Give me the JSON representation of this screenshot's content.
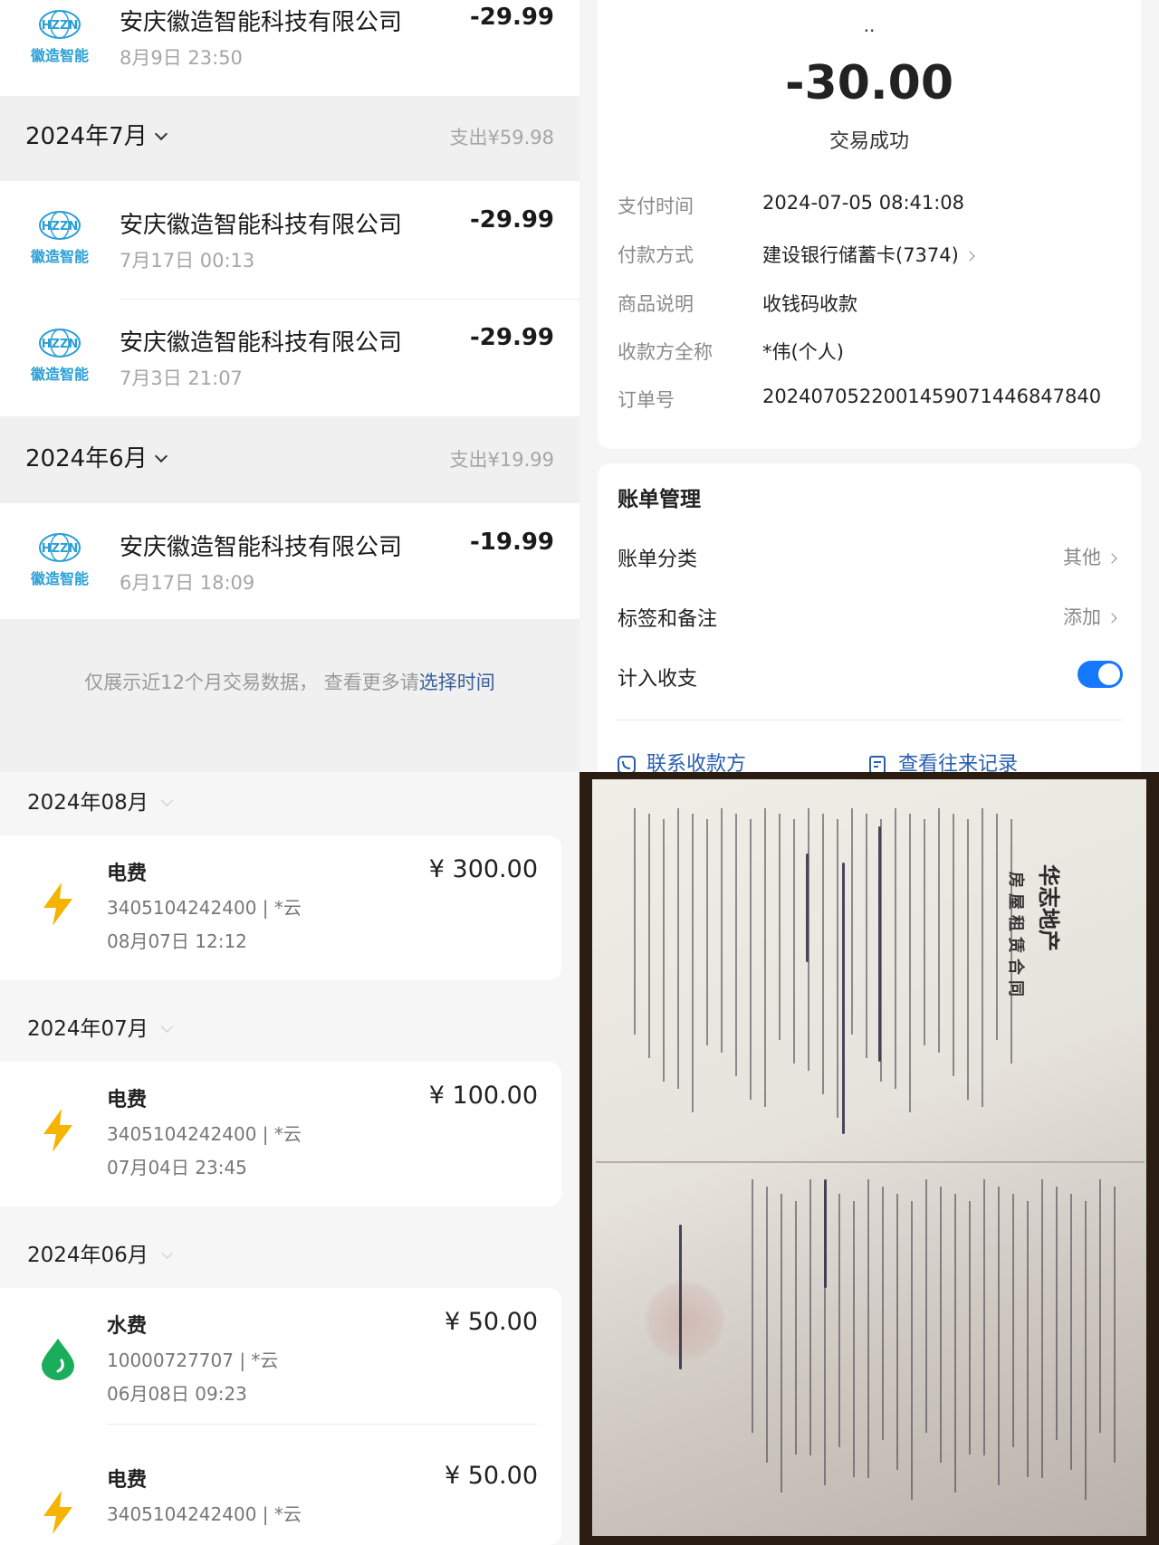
{
  "transactions_panel": {
    "brand_text": "徽造智能",
    "globe_text": "HZZN",
    "top_txn": {
      "name": "安庆徽造智能科技有限公司",
      "time": "8月9日 23:50",
      "amount": "-29.99"
    },
    "months": [
      {
        "label": "2024年7月",
        "summary": "支出¥59.98"
      },
      {
        "label": "2024年6月",
        "summary": "支出¥19.99"
      }
    ],
    "july_txns": [
      {
        "name": "安庆徽造智能科技有限公司",
        "time": "7月17日 00:13",
        "amount": "-29.99"
      },
      {
        "name": "安庆徽造智能科技有限公司",
        "time": "7月3日 21:07",
        "amount": "-29.99"
      }
    ],
    "june_txns": [
      {
        "name": "安庆徽造智能科技有限公司",
        "time": "6月17日 18:09",
        "amount": "-19.99"
      }
    ],
    "footnote": "仅展示近12个月交易数据， 查看更多请",
    "footnote_link": "选择时间"
  },
  "detail_panel": {
    "dots": "··",
    "amount": "-30.00",
    "status": "交易成功",
    "rows": [
      {
        "label": "支付时间",
        "value": "2024-07-05 08:41:08"
      },
      {
        "label": "付款方式",
        "value": "建设银行储蓄卡(7374)"
      },
      {
        "label": "商品说明",
        "value": "收钱码收款"
      },
      {
        "label": "收款方全称",
        "value": "*伟(个人)"
      },
      {
        "label": "订单号",
        "value": "2024070522001459071446847840"
      }
    ],
    "mgmt_title": "账单管理",
    "category_label": "账单分类",
    "category_value": "其他",
    "tags_label": "标签和备注",
    "tags_value": "添加",
    "include_label": "计入收支",
    "include_on": true,
    "contact_label": "联系收款方",
    "history_label": "查看往来记录"
  },
  "utility_panel": {
    "months": [
      {
        "label": "2024年08月"
      },
      {
        "label": "2024年07月"
      },
      {
        "label": "2024年06月"
      }
    ],
    "bills": [
      {
        "type": "电费",
        "account": "3405104242400 | *云",
        "time": "08月07日 12:12",
        "amount": "¥ 300.00",
        "icon": "lightning-icon"
      },
      {
        "type": "电费",
        "account": "3405104242400 | *云",
        "time": "07月04日 23:45",
        "amount": "¥ 100.00",
        "icon": "lightning-icon"
      },
      {
        "type": "水费",
        "account": "10000727707 | *云",
        "time": "06月08日 09:23",
        "amount": "¥ 50.00",
        "icon": "water-drop-icon"
      },
      {
        "type": "电费",
        "account": "3405104242400 | *云",
        "time": "",
        "amount": "¥ 50.00",
        "icon": "lightning-icon"
      }
    ],
    "colors": {
      "electric": "#f6b400",
      "water": "#1aad5c"
    }
  },
  "contract_photo": {
    "title": "华志地产",
    "subtitle": "房屋租赁合同"
  }
}
